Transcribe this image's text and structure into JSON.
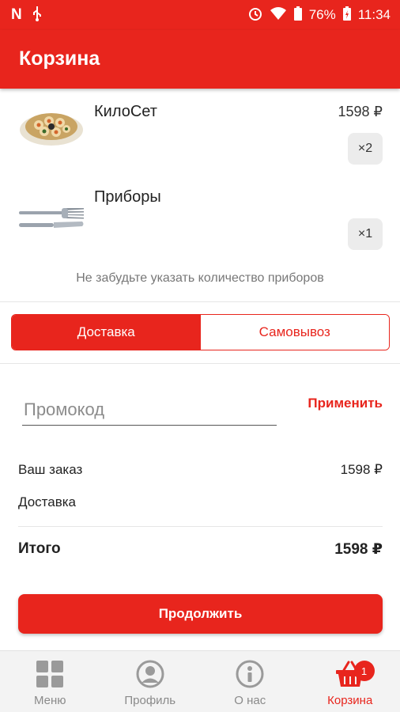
{
  "status_bar": {
    "battery": "76%",
    "time": "11:34"
  },
  "header": {
    "title": "Корзина"
  },
  "cart": {
    "items": [
      {
        "name": "КилоСет",
        "price": "1598 ₽",
        "quantity": "×2",
        "image": "sushi-set-image"
      },
      {
        "name": "Приборы",
        "price": "",
        "quantity": "×1",
        "image": "cutlery-image"
      }
    ],
    "reminder": "Не забудьте указать количество приборов"
  },
  "delivery_toggle": {
    "options": [
      "Доставка",
      "Самовывоз"
    ],
    "selected": "Доставка"
  },
  "promo": {
    "placeholder": "Промокод",
    "value": "",
    "apply_label": "Применить"
  },
  "summary": {
    "order_label": "Ваш заказ",
    "order_value": "1598 ₽",
    "delivery_label": "Доставка",
    "delivery_value": "",
    "total_label": "Итого",
    "total_value": "1598 ₽"
  },
  "continue_label": "Продолжить",
  "bottom_nav": {
    "items": [
      {
        "label": "Меню",
        "icon": "grid-icon"
      },
      {
        "label": "Профиль",
        "icon": "profile-icon"
      },
      {
        "label": "О нас",
        "icon": "info-icon"
      },
      {
        "label": "Корзина",
        "icon": "basket-icon",
        "badge": "1",
        "active": true
      }
    ]
  },
  "colors": {
    "accent": "#e8251d",
    "nav_bg": "#f3f3f3",
    "inactive": "#8a8a8a"
  }
}
